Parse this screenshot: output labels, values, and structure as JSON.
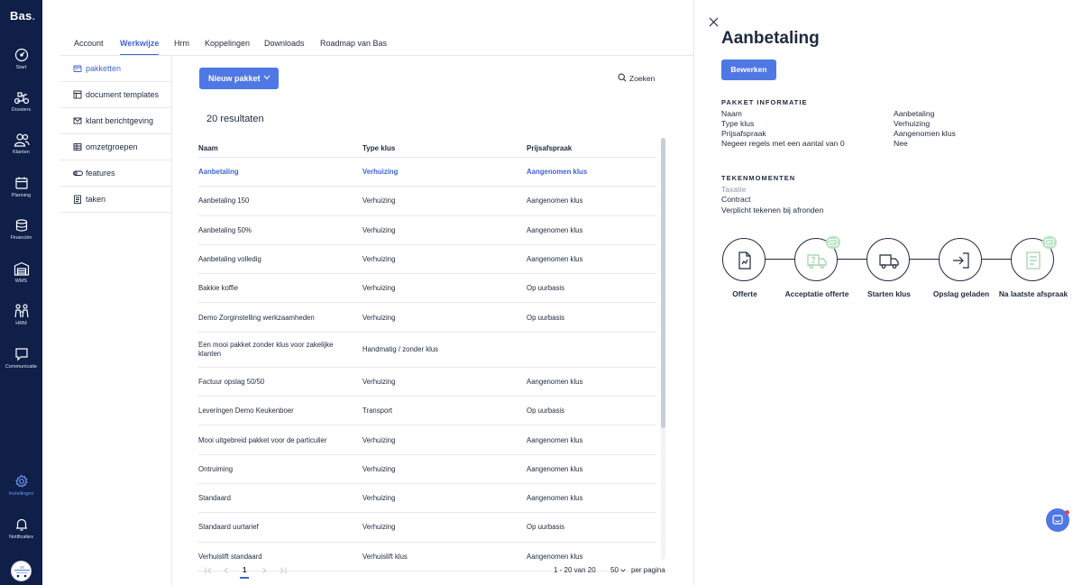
{
  "app": {
    "logo": "Bas",
    "logo_dot": "."
  },
  "rail": [
    {
      "label": "Start",
      "icon": "dashboard-icon"
    },
    {
      "label": "Dossiers",
      "icon": "scooter-icon"
    },
    {
      "label": "Klanten",
      "icon": "users-icon"
    },
    {
      "label": "Planning",
      "icon": "calendar-icon"
    },
    {
      "label": "Financiën",
      "icon": "coins-icon"
    },
    {
      "label": "WMS",
      "icon": "warehouse-icon"
    },
    {
      "label": "HRM",
      "icon": "people-icon"
    },
    {
      "label": "Communicatie",
      "icon": "chat-icon"
    },
    {
      "label": "Instellingen",
      "icon": "gear-icon",
      "active": true
    },
    {
      "label": "Notificaties",
      "icon": "bell-icon"
    }
  ],
  "tabs": [
    "Account",
    "Werkwijze",
    "Hrm",
    "Koppelingen",
    "Downloads",
    "Roadmap van Bas"
  ],
  "active_tab": "Werkwijze",
  "subnav": [
    {
      "label": "pakketten",
      "icon": "package-icon",
      "active": true
    },
    {
      "label": "document templates",
      "icon": "template-icon"
    },
    {
      "label": "klant berichtgeving",
      "icon": "mail-icon"
    },
    {
      "label": "omzetgroepen",
      "icon": "table-icon"
    },
    {
      "label": "features",
      "icon": "toggle-icon"
    },
    {
      "label": "taken",
      "icon": "checklist-icon"
    }
  ],
  "toolbar": {
    "new_package": "Nieuw pakket",
    "search": "Zoeken"
  },
  "results_label": "20 resultaten",
  "table": {
    "columns": [
      "Naam",
      "Type klus",
      "Prijsafspraak"
    ],
    "rows": [
      [
        "Aanbetaling",
        "Verhuizing",
        "Aangenomen klus"
      ],
      [
        "Aanbetaling 150",
        "Verhuizing",
        "Aangenomen klus"
      ],
      [
        "Aanbetaling 50%",
        "Verhuizing",
        "Aangenomen klus"
      ],
      [
        "Aanbetaling volledig",
        "Verhuizing",
        "Aangenomen klus"
      ],
      [
        "Bakkie koffie",
        "Verhuizing",
        "Op uurbasis"
      ],
      [
        "Demo Zorginstelling werkzaamheden",
        "Verhuizing",
        "Op uurbasis"
      ],
      [
        "Een mooi pakket zonder klus voor zakelijke klanten",
        "Handmatig / zonder klus",
        ""
      ],
      [
        "Factuur opslag 50/50",
        "Verhuizing",
        "Aangenomen klus"
      ],
      [
        "Leveringen Demo Keukenboer",
        "Transport",
        "Op uurbasis"
      ],
      [
        "Mooi uitgebreid pakket voor de particulier",
        "Verhuizing",
        "Aangenomen klus"
      ],
      [
        "Ontruiming",
        "Verhuizing",
        "Aangenomen klus"
      ],
      [
        "Standaard",
        "Verhuizing",
        "Aangenomen klus"
      ],
      [
        "Standaard uurtarief",
        "Verhuizing",
        "Op uurbasis"
      ],
      [
        "Verhuislift standaard",
        "Verhuislift klus",
        "Aangenomen klus"
      ]
    ]
  },
  "pager": {
    "page": "1",
    "range": "1 - 20 van 20",
    "page_size": "50",
    "per_page": "per pagina"
  },
  "detail": {
    "title": "Aanbetaling",
    "edit_button": "Bewerken",
    "info_heading": "PAKKET INFORMATIE",
    "info": [
      {
        "key": "Naam",
        "value": "Aanbetaling"
      },
      {
        "key": "Type klus",
        "value": "Verhuizing"
      },
      {
        "key": "Prijsafspraak",
        "value": "Aangenomen klus"
      },
      {
        "key": "Negeer regels met een aantal van 0",
        "value": "Nee"
      }
    ],
    "sign_heading": "TEKENMOMENTEN",
    "sign_items": [
      {
        "label": "Taxatie",
        "muted": true
      },
      {
        "label": "Contract",
        "muted": false
      },
      {
        "label": "Verplicht tekenen bij afronden",
        "muted": false
      }
    ],
    "steps": [
      {
        "label": "Offerte",
        "icon": "document-icon",
        "badge": false
      },
      {
        "label": "Acceptatie offerte",
        "icon": "truck-question-icon",
        "badge": true
      },
      {
        "label": "Starten klus",
        "icon": "truck-icon",
        "badge": false
      },
      {
        "label": "Opslag geladen",
        "icon": "login-arrow-icon",
        "badge": false
      },
      {
        "label": "Na laatste afspraak",
        "icon": "checklist-icon",
        "badge": true
      }
    ]
  },
  "colors": {
    "primary": "#4f78e4",
    "sidebar": "#0f1f47",
    "link": "#3f66cf",
    "badge": "#b9e4c4"
  }
}
